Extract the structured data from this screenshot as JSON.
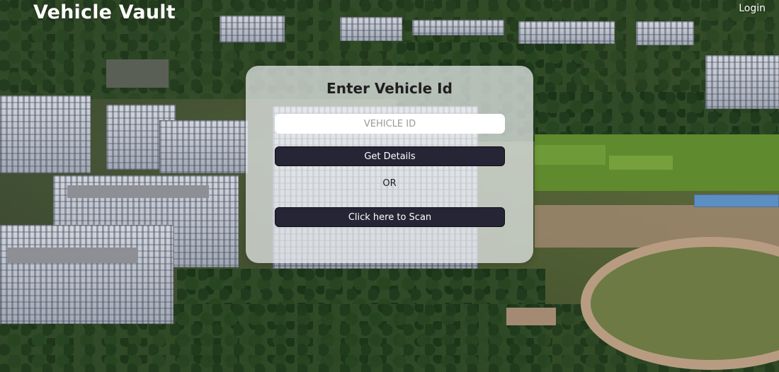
{
  "header": {
    "brand": "Vehicle Vault",
    "login_label": "Login"
  },
  "card": {
    "title": "Enter Vehicle Id",
    "vehicle_id_input": {
      "placeholder": "VEHICLE ID",
      "value": ""
    },
    "get_details_label": "Get Details",
    "or_label": "OR",
    "scan_label": "Click here to Scan"
  },
  "colors": {
    "button_bg": "#262535",
    "card_bg": "rgba(235,238,240,0.72)",
    "text_light": "#ffffff"
  }
}
